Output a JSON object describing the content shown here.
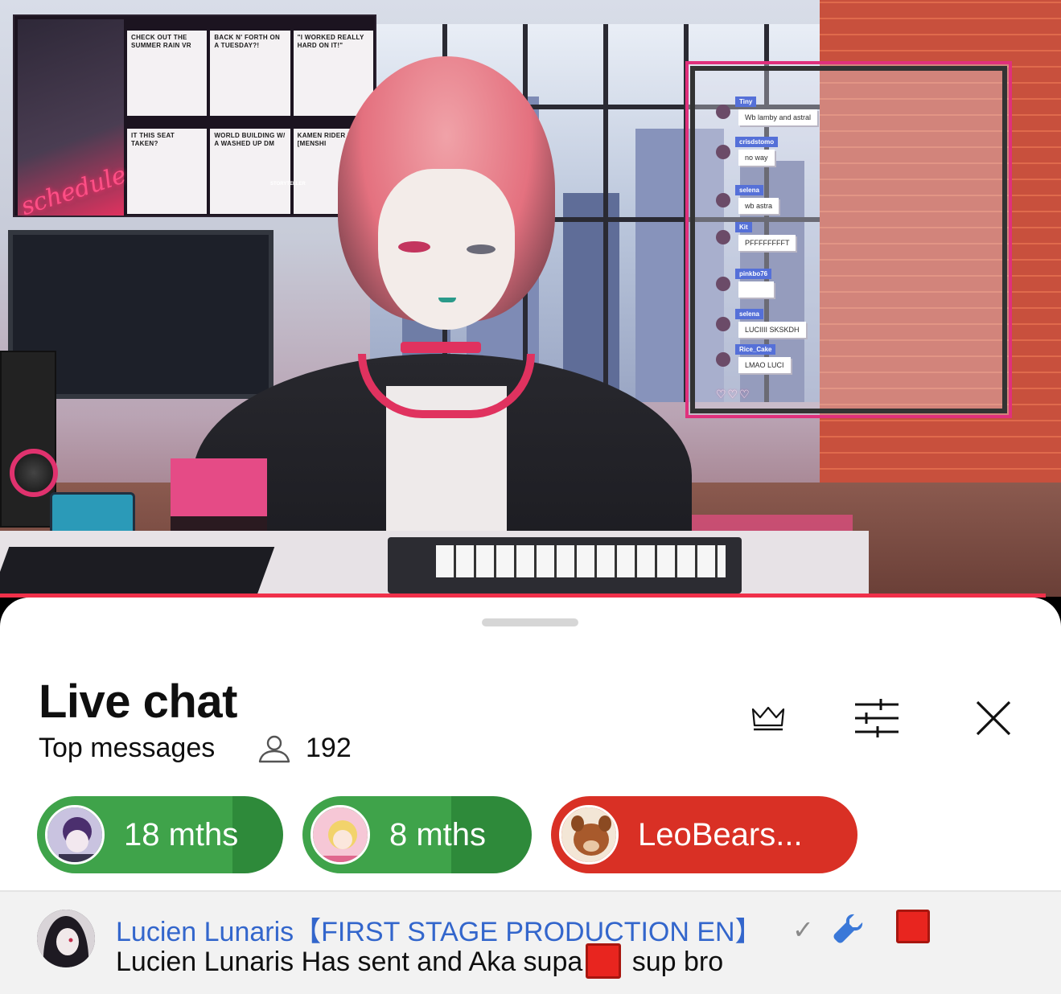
{
  "stream": {
    "schedule_panel": {
      "script_title": "schedule",
      "cards": [
        "CHECK OUT THE SUMMER RAIN VR",
        "BACK N' FORTH ON A TUESDAY?!",
        "\"I WORKED REALLY HARD ON IT!\"",
        "IT THIS SEAT TAKEN?",
        "WORLD BUILDING W/ A WASHED UP DM",
        "KAMEN RIDER ZEZTZ [MENSHI"
      ],
      "storyteller_label": "STORYTELLER"
    },
    "overlay_chat": {
      "messages": [
        {
          "name": "Tiny",
          "text": "Wb lamby and astral"
        },
        {
          "name": "crisdstomo",
          "text": "no way"
        },
        {
          "name": "selena",
          "text": "wb astra"
        },
        {
          "name": "Kit",
          "text": "PFFFFFFFFT"
        },
        {
          "name": "pinkbo76",
          "text": ""
        },
        {
          "name": "selena",
          "text": "LUCIIII SKSKDH"
        },
        {
          "name": "Rice_Cake",
          "text": "LMAO LUCI"
        }
      ],
      "hearts": "♡♡♡"
    },
    "progress": 0.985
  },
  "live_chat": {
    "title": "Live chat",
    "subtitle": "Top messages",
    "viewer_count": "192",
    "icons": {
      "viewers": "person-outline-icon",
      "crown": "crown-icon",
      "filter": "sliders-icon",
      "close": "close-x-icon"
    }
  },
  "ticker": {
    "chips": [
      {
        "label": "18 mths",
        "color": "#3fa34a",
        "progress": 0.79
      },
      {
        "label": "8 mths",
        "color": "#3fa34a",
        "progress": 0.65
      },
      {
        "label": "LeoBears...",
        "color": "#d93025",
        "progress": 1.0
      }
    ]
  },
  "pinned_message": {
    "author": "Lucien Lunaris【FIRST STAGE PRODUCTION EN】",
    "verified": "✓",
    "text_before": "Lucien Lunaris Has sent and Aka supa",
    "text_after": " sup bro",
    "colors": {
      "author": "#3366cc",
      "red_square": "#e8251f"
    }
  }
}
